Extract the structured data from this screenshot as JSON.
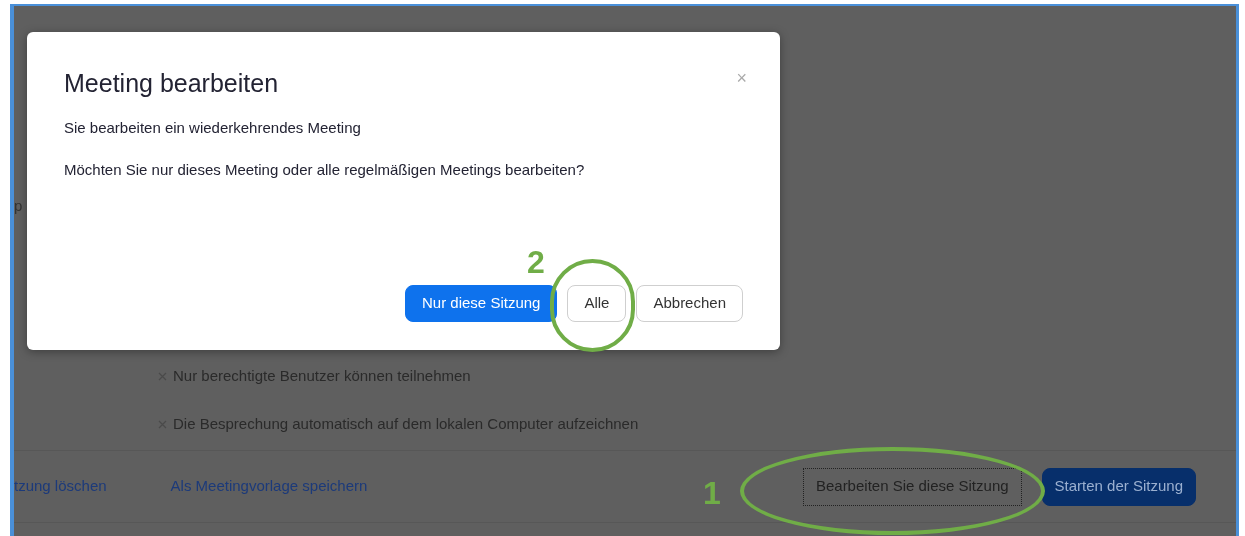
{
  "background_page": {
    "cut_label": "p",
    "settings": [
      {
        "label": "Nur berechtigte Benutzer können teilnehmen",
        "checked": false
      },
      {
        "label": "Die Besprechung automatisch auf dem lokalen Computer aufzeichnen",
        "checked": false
      }
    ],
    "footer": {
      "links": [
        "tzung löschen",
        "Als Meetingvorlage speichern"
      ],
      "buttons": [
        {
          "label": "Bearbeiten Sie diese Sitzung",
          "kind": "secondary"
        },
        {
          "label": "Starten der Sitzung",
          "kind": "primary"
        }
      ]
    }
  },
  "dialog": {
    "title": "Meeting bearbeiten",
    "close": "×",
    "message": "Sie bearbeiten ein wiederkehrendes Meeting",
    "question": "Möchten Sie nur dieses Meeting oder alle regelmäßigen Meetings bearbeiten?",
    "buttons": [
      {
        "label": "Nur diese Sitzung",
        "kind": "primary"
      },
      {
        "label": "Alle",
        "kind": "secondary"
      },
      {
        "label": "Abbrechen",
        "kind": "secondary"
      }
    ]
  },
  "annotations": [
    {
      "number": "1",
      "kind": "ellipse"
    },
    {
      "number": "2",
      "kind": "circle"
    }
  ]
}
